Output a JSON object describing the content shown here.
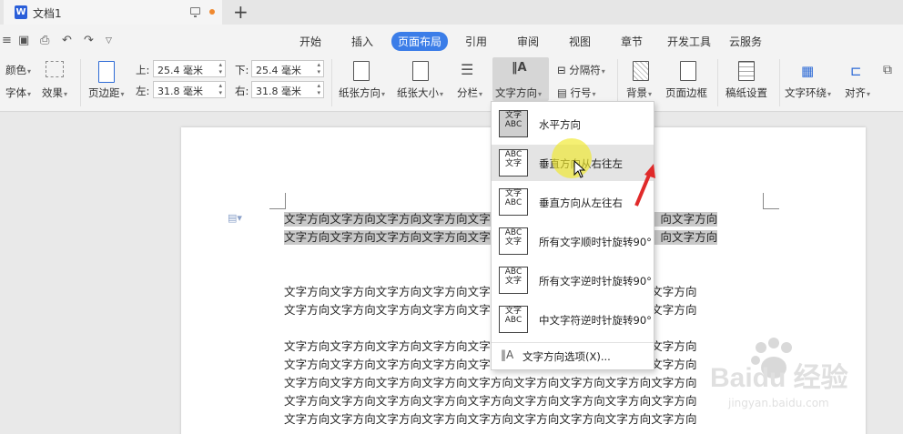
{
  "titlebar": {
    "doc_name": "文档1",
    "doc_icon_letter": "W",
    "new_tab": "+"
  },
  "menu": {
    "items": [
      "开始",
      "插入",
      "页面布局",
      "引用",
      "审阅",
      "视图",
      "章节",
      "开发工具",
      "云服务"
    ],
    "active": "页面布局"
  },
  "ribbon": {
    "color_label": "颜色",
    "font_label": "字体",
    "effect_label": "效果",
    "margin_label": "页边距",
    "top_label": "上:",
    "bottom_label": "下:",
    "left_label": "左:",
    "right_label": "右:",
    "top_value": "25.4 毫米",
    "bottom_value": "25.4 毫米",
    "left_value": "31.8 毫米",
    "right_value": "31.8 毫米",
    "orientation_label": "纸张方向",
    "size_label": "纸张大小",
    "columns_label": "分栏",
    "text_dir_label": "文字方向",
    "break_label": "分隔符",
    "line_num_label": "行号",
    "background_label": "背景",
    "border_label": "页面边框",
    "grid_paper_label": "稿纸设置",
    "wrap_label": "文字环绕",
    "align_label": "对齐"
  },
  "dropdown": {
    "items": [
      {
        "label": "水平方向",
        "icon": "文字\nABC"
      },
      {
        "label": "垂直方向从右往左",
        "icon": "ABC 文字"
      },
      {
        "label": "垂直方向从左往右",
        "icon": "文字 ABC"
      },
      {
        "label": "所有文字顺时针旋转90°",
        "icon": "ABC 文字"
      },
      {
        "label": "所有文字逆时针旋转90°",
        "icon": "ABC 文字"
      },
      {
        "label": "中文字符逆时针旋转90°",
        "icon": "文字 ABC"
      }
    ],
    "footer": "文字方向选项(X)..."
  },
  "document": {
    "line_text": "文字方向文字方向文字方向文字方向文字方向文字方向文字方向文字方向文字方向",
    "line_text_left": "文字方向文字方向文字方向文字方向文字方",
    "line_text_right": "向文字方向"
  },
  "watermark": {
    "brand": "Baidu 经验",
    "url": "jingyan.baidu.com"
  }
}
